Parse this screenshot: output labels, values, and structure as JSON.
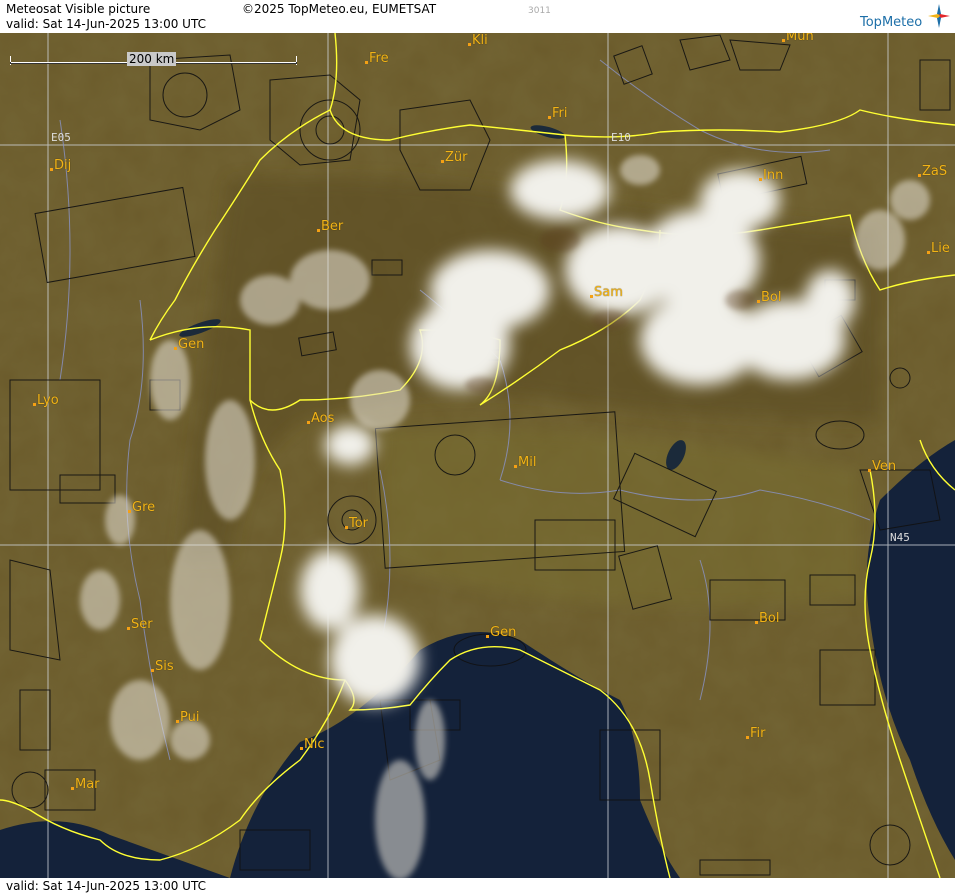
{
  "header": {
    "title": "Meteosat Visible picture",
    "valid_line": "valid:  Sat  14-Jun-2025  13:00 UTC",
    "copyright": "©2025 TopMeteo.eu, EUMETSAT",
    "code": "3011",
    "logo_text": "TopMeteo"
  },
  "footer": {
    "valid_line": "valid:  Sat  14-Jun-2025  13:00 UTC"
  },
  "scale": {
    "label": "200 km"
  },
  "grid_labels": {
    "lon1": "E05",
    "lon2": "E10",
    "lat1": "N45"
  },
  "cities": {
    "kli": "Kli",
    "fre": "Fre",
    "mun": "Mun",
    "fri": "Fri",
    "zur": "Zür",
    "inn": "Inn",
    "zas": "ZaS",
    "dij": "Dij",
    "ber": "Ber",
    "lie": "Lie",
    "sam": "Sam",
    "bol_n": "Bol",
    "gen_w": "Gen",
    "lyo": "Lyo",
    "aos": "Aos",
    "mil": "Mil",
    "ven": "Ven",
    "gre": "Gre",
    "tor": "Tor",
    "ser": "Ser",
    "bol_s": "Bol",
    "gen_s": "Gen",
    "sis": "Sis",
    "pui": "Pui",
    "nic": "Nic",
    "fir": "Fir",
    "mar": "Mar"
  },
  "colors": {
    "land": "#6a5a2a",
    "sea": "#142235",
    "border": "#ffff33",
    "city_label": "#f2b417",
    "cloud": "#f1f0ea"
  }
}
